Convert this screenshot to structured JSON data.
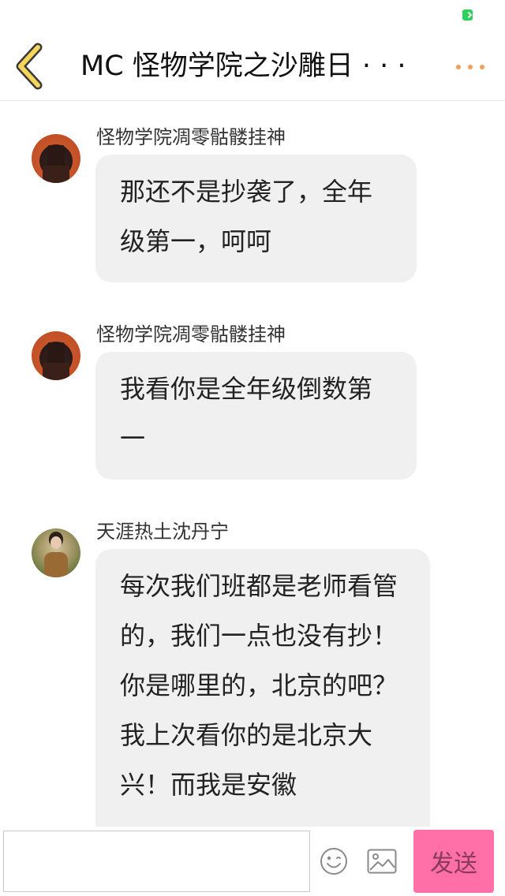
{
  "header": {
    "title": "MC 怪物学院之沙雕日 · · ·"
  },
  "icons": {
    "back": "chevron-left-icon",
    "more": "more-dots-icon",
    "emoji": "smiley-icon",
    "image": "image-icon",
    "battery": "battery-icon"
  },
  "colors": {
    "accent_back": "#f5d65a",
    "more_dots": "#f0a05a",
    "send_button": "#ff6fa8",
    "bubble_bg": "#f0f0f0",
    "battery": "#2fd05a"
  },
  "messages": [
    {
      "sender": "怪物学院凋零骷髅挂神",
      "text": "那还不是抄袭了，全年级第一，呵呵"
    },
    {
      "sender": "怪物学院凋零骷髅挂神",
      "text": "我看你是全年级倒数第一"
    },
    {
      "sender": "天涯热土沈丹宁",
      "text": "每次我们班都是老师看管的，我们一点也没有抄！你是哪里的，北京的吧？我上次看你的是北京大兴！而我是安徽"
    }
  ],
  "composer": {
    "placeholder": "",
    "send_label": "发送"
  }
}
